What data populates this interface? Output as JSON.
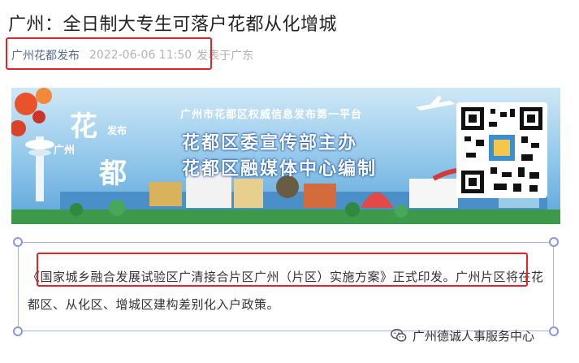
{
  "article": {
    "title": "广州：全日制大专生可落户花都从化增城",
    "author": "广州花都发布",
    "date": "2022-06-06 11:50",
    "location": "发表于广东"
  },
  "banner": {
    "logo_hua": "花",
    "logo_du": "都",
    "logo_guangzhou": "广州",
    "logo_fabu": "发布",
    "platform": "广州市花都区权威信息发布第一平台",
    "line1": "花都区委宣传部主办",
    "line2": "花都区融媒体中心编制"
  },
  "body": {
    "paragraph": "《国家城乡融合发展试验区广清接合片区广州（片区）实施方案》正式印发。广州片区将在花都区、从化区、增城区建构差别化入户政策。"
  },
  "watermark": {
    "icon": "wechat-icon",
    "text": "广州德诚人事服务中心"
  },
  "colors": {
    "highlight": "#e8202a",
    "author_link": "#576b95",
    "frame": "#a9b4e0"
  }
}
